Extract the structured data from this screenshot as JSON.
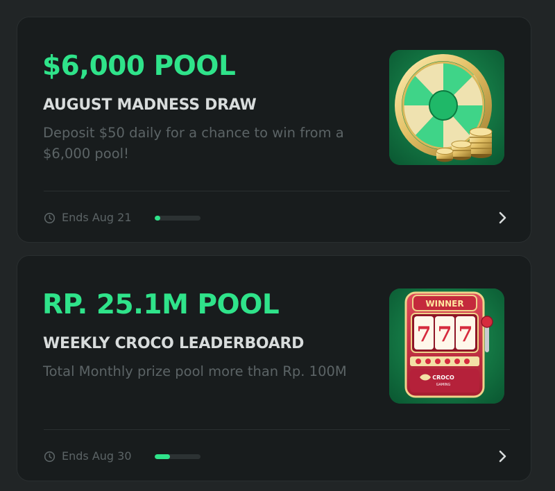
{
  "promotions": [
    {
      "pool": "$6,000 POOL",
      "name": "AUGUST MADNESS DRAW",
      "description": "Deposit $50 daily for a chance to win from a $6,000 pool!",
      "ends": "Ends Aug 21",
      "progress_percent": 12,
      "thumbnail": "gold-wheel-coins-image"
    },
    {
      "pool": "RP. 25.1M POOL",
      "name": "WEEKLY CROCO LEADERBOARD",
      "description": "Total Monthly prize pool more than Rp. 100M",
      "ends": "Ends Aug 30",
      "progress_percent": 33,
      "thumbnail": "slot-machine-winner-image",
      "thumbnail_text": {
        "banner": "WINNER",
        "reels": [
          "7",
          "7",
          "7"
        ],
        "brand": "CROCO",
        "brand_sub": "GAMING"
      }
    }
  ],
  "colors": {
    "accent": "#2fe38a",
    "card_bg": "#181c1d",
    "page_bg": "#212526",
    "muted_text": "#5c6466",
    "heading_text": "#d8dcdc"
  },
  "icons": {
    "footer": "clock-icon",
    "action": "chevron-right-icon"
  }
}
